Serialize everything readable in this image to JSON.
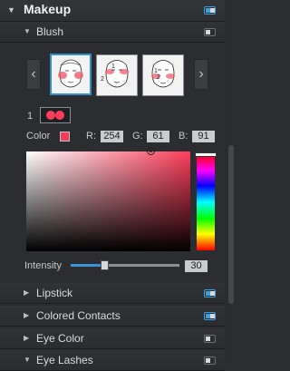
{
  "header": {
    "title": "Makeup"
  },
  "blush": {
    "label": "Blush",
    "prev_label": "‹",
    "next_label": "›",
    "faces": [
      {
        "number": ""
      },
      {
        "number": "1\n2"
      },
      {
        "number": "1\n2"
      }
    ],
    "region_number": "1",
    "color_label": "Color",
    "r_label": "R:",
    "g_label": "G:",
    "b_label": "B:",
    "r": "254",
    "g": "61",
    "b": "91",
    "intensity_label": "Intensity",
    "intensity_value": "30",
    "accent": "#fe3d5b"
  },
  "sections": [
    {
      "label": "Lipstick"
    },
    {
      "label": "Colored Contacts"
    },
    {
      "label": "Eye Color"
    },
    {
      "label": "Eye Lashes"
    }
  ]
}
